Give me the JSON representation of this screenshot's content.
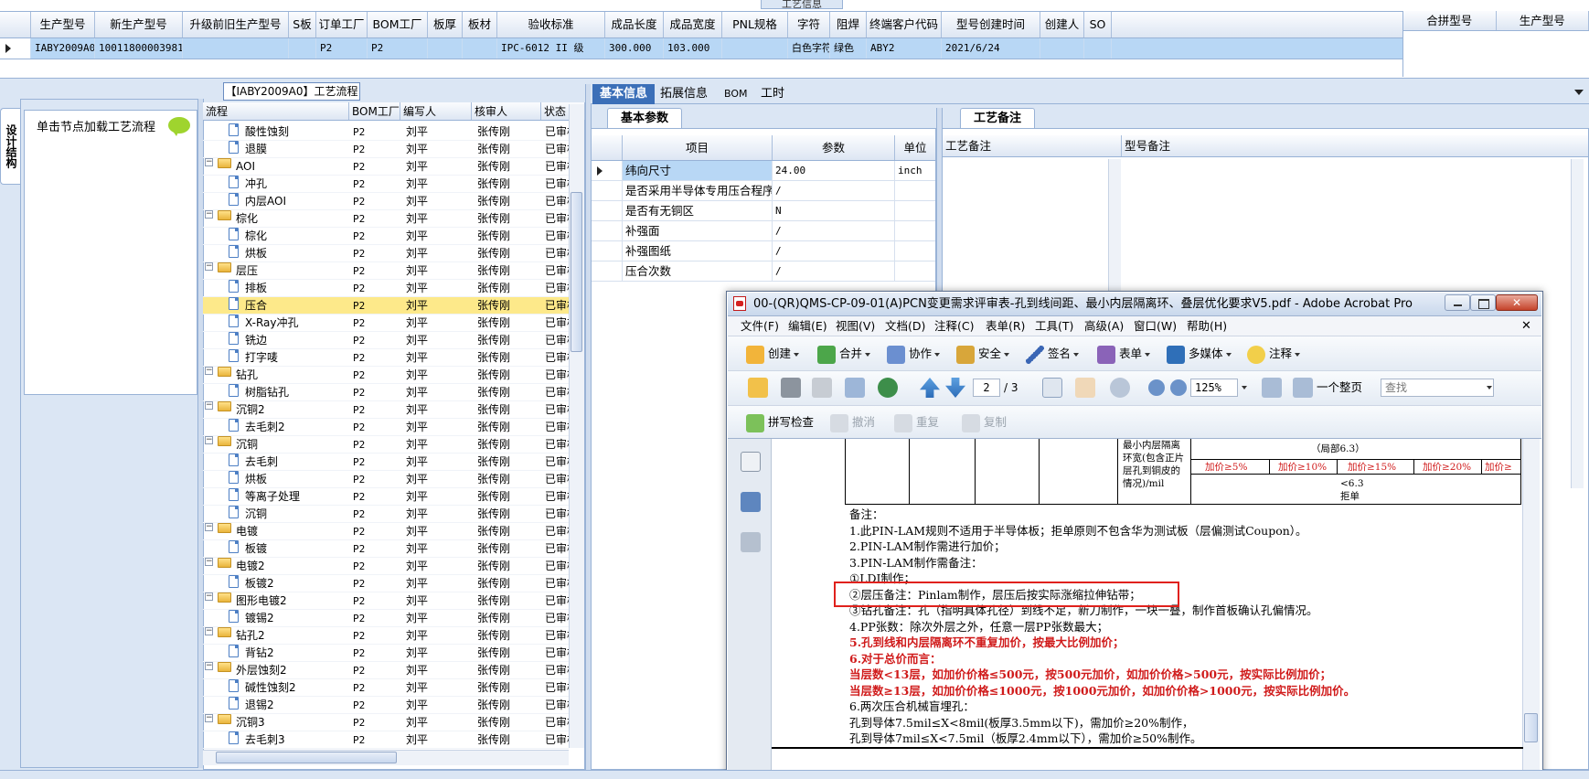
{
  "top": {
    "caption": "工艺信息",
    "columns": [
      "生产型号",
      "新生产型号",
      "升级前旧生产型号",
      "S板",
      "订单工厂",
      "BOM工厂",
      "板厚",
      "板材",
      "验收标准",
      "成品长度",
      "成品宽度",
      "PNL规格",
      "字符",
      "阻焊",
      "终端客户代码",
      "型号创建时间",
      "创建人",
      "SO"
    ],
    "row": [
      "IABY2009A0",
      "10011800003981",
      "",
      "",
      "P2",
      "P2",
      "",
      "",
      "IPC-6012 II 级",
      "300.000",
      "103.000",
      "",
      "白色字符",
      "绿色",
      "ABY2",
      "2021/6/24",
      "",
      ""
    ],
    "right_columns": [
      "合拼型号",
      "生产型号"
    ]
  },
  "left_panel": {
    "vertical_tab": "设计结构",
    "load_label": "单击节点加载工艺流程"
  },
  "process": {
    "title": "【IABY2009A0】工艺流程",
    "columns": [
      "流程",
      "BOM工厂",
      "编写人",
      "核审人",
      "状态"
    ],
    "rows": [
      {
        "name": "酸性蚀刻",
        "kind": "doc",
        "factory": "P2",
        "author": "刘平",
        "reviewer": "张传刚",
        "status": "已审核"
      },
      {
        "name": "退膜",
        "kind": "doc",
        "factory": "P2",
        "author": "刘平",
        "reviewer": "张传刚",
        "status": "已审核"
      },
      {
        "name": "AOI",
        "kind": "folder",
        "factory": "P2",
        "author": "刘平",
        "reviewer": "张传刚",
        "status": "已审核"
      },
      {
        "name": "冲孔",
        "kind": "doc",
        "factory": "P2",
        "author": "刘平",
        "reviewer": "张传刚",
        "status": "已审核"
      },
      {
        "name": "内层AOI",
        "kind": "doc",
        "factory": "P2",
        "author": "刘平",
        "reviewer": "张传刚",
        "status": "已审核"
      },
      {
        "name": "棕化",
        "kind": "folder",
        "factory": "P2",
        "author": "刘平",
        "reviewer": "张传刚",
        "status": "已审核"
      },
      {
        "name": "棕化",
        "kind": "doc",
        "factory": "P2",
        "author": "刘平",
        "reviewer": "张传刚",
        "status": "已审核"
      },
      {
        "name": "烘板",
        "kind": "doc",
        "factory": "P2",
        "author": "刘平",
        "reviewer": "张传刚",
        "status": "已审核"
      },
      {
        "name": "层压",
        "kind": "folder",
        "factory": "P2",
        "author": "刘平",
        "reviewer": "张传刚",
        "status": "已审核"
      },
      {
        "name": "排板",
        "kind": "doc",
        "factory": "P2",
        "author": "刘平",
        "reviewer": "张传刚",
        "status": "已审核"
      },
      {
        "name": "压合",
        "kind": "doc",
        "factory": "P2",
        "author": "刘平",
        "reviewer": "张传刚",
        "status": "已审核",
        "selected": true
      },
      {
        "name": "X-Ray冲孔",
        "kind": "doc",
        "factory": "P2",
        "author": "刘平",
        "reviewer": "张传刚",
        "status": "已审核"
      },
      {
        "name": "铣边",
        "kind": "doc",
        "factory": "P2",
        "author": "刘平",
        "reviewer": "张传刚",
        "status": "已审核"
      },
      {
        "name": "打字唛",
        "kind": "doc",
        "factory": "P2",
        "author": "刘平",
        "reviewer": "张传刚",
        "status": "已审核"
      },
      {
        "name": "钻孔",
        "kind": "folder",
        "factory": "P2",
        "author": "刘平",
        "reviewer": "张传刚",
        "status": "已审核"
      },
      {
        "name": "树脂钻孔",
        "kind": "doc",
        "factory": "P2",
        "author": "刘平",
        "reviewer": "张传刚",
        "status": "已审核"
      },
      {
        "name": "沉铜2",
        "kind": "folder",
        "factory": "P2",
        "author": "刘平",
        "reviewer": "张传刚",
        "status": "已审核"
      },
      {
        "name": "去毛刺2",
        "kind": "doc",
        "factory": "P2",
        "author": "刘平",
        "reviewer": "张传刚",
        "status": "已审核"
      },
      {
        "name": "沉铜",
        "kind": "folder",
        "factory": "P2",
        "author": "刘平",
        "reviewer": "张传刚",
        "status": "已审核"
      },
      {
        "name": "去毛刺",
        "kind": "doc",
        "factory": "P2",
        "author": "刘平",
        "reviewer": "张传刚",
        "status": "已审核"
      },
      {
        "name": "烘板",
        "kind": "doc",
        "factory": "P2",
        "author": "刘平",
        "reviewer": "张传刚",
        "status": "已审核"
      },
      {
        "name": "等离子处理",
        "kind": "doc",
        "factory": "P2",
        "author": "刘平",
        "reviewer": "张传刚",
        "status": "已审核"
      },
      {
        "name": "沉铜",
        "kind": "doc",
        "factory": "P2",
        "author": "刘平",
        "reviewer": "张传刚",
        "status": "已审核"
      },
      {
        "name": "电镀",
        "kind": "folder",
        "factory": "P2",
        "author": "刘平",
        "reviewer": "张传刚",
        "status": "已审核"
      },
      {
        "name": "板镀",
        "kind": "doc",
        "factory": "P2",
        "author": "刘平",
        "reviewer": "张传刚",
        "status": "已审核"
      },
      {
        "name": "电镀2",
        "kind": "folder",
        "factory": "P2",
        "author": "刘平",
        "reviewer": "张传刚",
        "status": "已审核"
      },
      {
        "name": "板镀2",
        "kind": "doc",
        "factory": "P2",
        "author": "刘平",
        "reviewer": "张传刚",
        "status": "已审核"
      },
      {
        "name": "图形电镀2",
        "kind": "folder",
        "factory": "P2",
        "author": "刘平",
        "reviewer": "张传刚",
        "status": "已审核"
      },
      {
        "name": "镀锡2",
        "kind": "doc",
        "factory": "P2",
        "author": "刘平",
        "reviewer": "张传刚",
        "status": "已审核"
      },
      {
        "name": "钻孔2",
        "kind": "folder",
        "factory": "P2",
        "author": "刘平",
        "reviewer": "张传刚",
        "status": "已审核"
      },
      {
        "name": "背钻2",
        "kind": "doc",
        "factory": "P2",
        "author": "刘平",
        "reviewer": "张传刚",
        "status": "已审核"
      },
      {
        "name": "外层蚀刻2",
        "kind": "folder",
        "factory": "P2",
        "author": "刘平",
        "reviewer": "张传刚",
        "status": "已审核"
      },
      {
        "name": "碱性蚀刻2",
        "kind": "doc",
        "factory": "P2",
        "author": "刘平",
        "reviewer": "张传刚",
        "status": "已审核"
      },
      {
        "name": "退锡2",
        "kind": "doc",
        "factory": "P2",
        "author": "刘平",
        "reviewer": "张传刚",
        "status": "已审核"
      },
      {
        "name": "沉铜3",
        "kind": "folder",
        "factory": "P2",
        "author": "刘平",
        "reviewer": "张传刚",
        "status": "已审核"
      },
      {
        "name": "去毛刺3",
        "kind": "doc",
        "factory": "P2",
        "author": "刘平",
        "reviewer": "张传刚",
        "status": "已审核"
      }
    ]
  },
  "info": {
    "tabs": [
      "基本信息",
      "拓展信息",
      "BOM",
      "工时"
    ],
    "param_tab": "基本参数",
    "param_columns": [
      "项目",
      "参数",
      "单位"
    ],
    "params": [
      {
        "k": "纬向尺寸",
        "v": "24.00",
        "u": "inch"
      },
      {
        "k": "是否采用半导体专用压合程序",
        "v": "/",
        "u": ""
      },
      {
        "k": "是否有无铜区",
        "v": "N",
        "u": ""
      },
      {
        "k": "补强面",
        "v": "/",
        "u": ""
      },
      {
        "k": "补强图纸",
        "v": "/",
        "u": ""
      },
      {
        "k": "压合次数",
        "v": "/",
        "u": ""
      }
    ],
    "remark_tab": "工艺备注",
    "remark_columns": [
      "工艺备注",
      "型号备注"
    ]
  },
  "acrobat": {
    "title": "00-(QR)QMS-CP-09-01(A)PCN变更需求评审表-孔到线间距、最小内层隔离环、叠层优化要求V5.pdf - Adobe Acrobat Pro",
    "menu": [
      "文件(F)",
      "编辑(E)",
      "视图(V)",
      "文档(D)",
      "注释(C)",
      "表单(R)",
      "工具(T)",
      "高级(A)",
      "窗口(W)",
      "帮助(H)"
    ],
    "toolbar1": [
      "创建",
      "合并",
      "协作",
      "安全",
      "签名",
      "表单",
      "多媒体",
      "注释"
    ],
    "page_current": "2",
    "page_total": "/ 3",
    "zoom": "125%",
    "page_fit": "一个整页",
    "search_placeholder": "查找",
    "toolbar3": [
      "拼写检查",
      "撤消",
      "重复",
      "复制"
    ],
    "pdf": {
      "cell_label": [
        "最小内层隔离",
        "环宽(包含正片",
        "层孔到铜皮的",
        "情况)/mil"
      ],
      "cell_local": "（局部6.3）",
      "cell_prices": [
        "加价≥5%",
        "加价≥10%",
        "加价≥15%",
        "加价≥20%",
        "加价≥"
      ],
      "cell_min": "<6.3",
      "cell_reject": "拒单",
      "notes": [
        {
          "t": "备注：",
          "red": false
        },
        {
          "t": "1.此PIN-LAM规则不适用于半导体板；拒单原则不包含华为测试板（层偏测试Coupon）。",
          "red": false
        },
        {
          "t": "2.PIN-LAM制作需进行加价；",
          "red": false
        },
        {
          "t": "3.PIN-LAM制作需备注：",
          "red": false
        },
        {
          "t": "①LDI制作；",
          "red": false
        },
        {
          "t": "②层压备注：Pinlam制作，层压后按实际涨缩拉伸钻带；",
          "red": false
        },
        {
          "t": "③钻孔备注：孔（指明具体孔径）到线不足，新刀制作，一块一叠，制作首板确认孔偏情况。",
          "red": false
        },
        {
          "t": "4.PP张数：除次外层之外，任意一层PP张数最大；",
          "red": false
        },
        {
          "t": "5.孔到线和内层隔离环不重复加价，按最大比例加价；",
          "red": true
        },
        {
          "t": "6.对于总价而言：",
          "red": true
        },
        {
          "t": "当层数<13层，如加价价格≤500元，按500元加价，如加价价格>500元，按实际比例加价；",
          "red": true
        },
        {
          "t": "当层数≥13层，如加价价格≤1000元，按1000元加价，如加价价格>1000元，按实际比例加价。",
          "red": true
        },
        {
          "t": "6.两次压合机械盲埋孔：",
          "red": false
        },
        {
          "t": "孔到导体7.5mil≤X<8mil(板厚3.5mm以下)，需加价≥20%制作，",
          "red": false
        },
        {
          "t": "孔到导体7mil≤X<7.5mil（板厚2.4mm以下），需加价≥50%制作。",
          "red": false
        }
      ]
    }
  },
  "colors": {
    "accent": "#3b6fb8",
    "selection": "#b8d7f5",
    "tree_selection": "#fde98a",
    "red": "#d01b1b",
    "redbox": "#e0211c"
  }
}
